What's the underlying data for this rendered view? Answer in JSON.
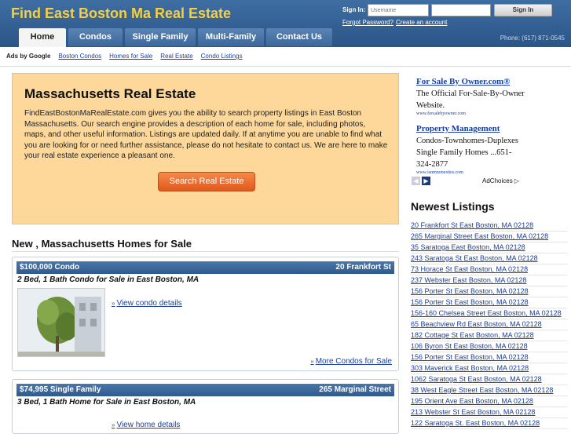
{
  "header": {
    "site_title": "Find East Boston Ma Real Estate",
    "signin_label": "Sign In:",
    "username_placeholder": "Username",
    "signin_button": "Sign In",
    "forgot_link": "Forgot Password?",
    "create_link": "Create an account",
    "phone": "Phone: (617) 871-0545",
    "nav": [
      {
        "label": "Home"
      },
      {
        "label": "Condos"
      },
      {
        "label": "Single Family"
      },
      {
        "label": "Multi-Family"
      },
      {
        "label": "Contact Us"
      }
    ]
  },
  "adsbar": {
    "label": "Ads by Google",
    "links": [
      "Boston Condos",
      "Homes for Sale",
      "Real Estate",
      "Condo Listings"
    ]
  },
  "hero": {
    "title": "Massachusetts Real Estate",
    "body": "FindEastBostonMaRealEstate.com gives you the ability to search property listings in East Boston Massachusetts. Our search engine provides a description of each home for sale, including photos, maps, and other useful information. Listings are updated daily. If at anytime you are unable to find what you are looking for or need further assistance, please do not hesitate to contact us. We are here to make your real estate experience a pleasant one.",
    "search_button": "Search  Real Estate"
  },
  "listings_section": {
    "title": "New , Massachusetts Homes for Sale",
    "cards": [
      {
        "price": "$100,000 Condo",
        "street": "20 Frankfort St",
        "subtitle": "2 Bed, 1 Bath Condo for Sale in East Boston, MA",
        "view_link": "View condo details",
        "more_link": "More Condos for Sale"
      },
      {
        "price": "$74,995 Single Family",
        "street": "265 Marginal Street",
        "subtitle": "3 Bed, 1 Bath Home for Sale in East Boston, MA",
        "view_link": "View home details"
      }
    ]
  },
  "sidebar": {
    "ads": [
      {
        "title": "For Sale By Owner.com®",
        "desc": "The Official For-Sale-By-Owner Website.",
        "url": "www.forsalebyowner.com"
      },
      {
        "title": "Property Management",
        "desc": "Condos-Townhomes-Duplexes Single Family Homes ...651-324-2877",
        "url": "www.isnmnonesties.com"
      }
    ],
    "adchoices": "AdChoices",
    "newest_title": "Newest Listings",
    "newest": [
      "20 Frankfort St East Boston, MA 02128",
      "265 Marginal Street East Boston, MA 02128",
      "35 Saratoga East Boston, MA 02128",
      "243 Saratoga St East Boston, MA 02128",
      "73 Horace St East Boston, MA 02128",
      "237 Webster East Boston, MA 02128",
      "156 Porter St East Boston, MA 02128",
      "156 Porter St East Boston, MA 02128",
      "156-160 Chelsea Street East Boston, MA 02128",
      "65 Beachview Rd East Boston, MA 02128",
      "182 Cottage St East Boston, MA 02128",
      "106 Byron St East Boston, MA 02128",
      "156 Porter St East Boston, MA 02128",
      "303 Maverick East Boston, MA 02128",
      "1062 Saratoga St East Boston, MA 02128",
      "38 West Eagle Street East Boston, MA 02128",
      "195 Orient Ave East Boston, MA 02128",
      "213 Webster St East Boston, MA 02128",
      "122 Saratoga St. East Boston, MA 02128"
    ]
  }
}
